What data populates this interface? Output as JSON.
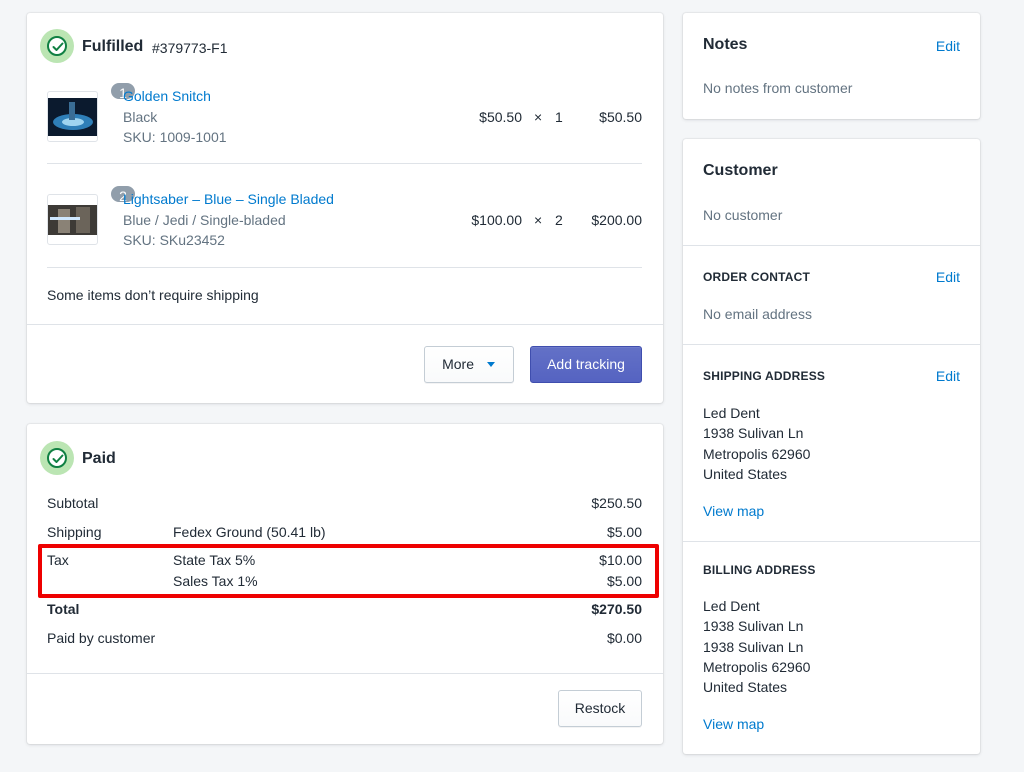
{
  "fulfillment": {
    "status": "Fulfilled",
    "order_id": "#379773-F1",
    "items": [
      {
        "quantity_badge": "1",
        "name": "Golden Snitch",
        "variant": "Black",
        "sku": "SKU: 1009-1001",
        "price": "$50.50",
        "times": "×",
        "qty": "1",
        "total": "$50.50"
      },
      {
        "quantity_badge": "2",
        "name": "Lightsaber – Blue – Single Bladed",
        "variant": "Blue / Jedi / Single-bladed",
        "sku": "SKU: SKu23452",
        "price": "$100.00",
        "times": "×",
        "qty": "2",
        "total": "$200.00"
      }
    ],
    "note": "Some items don’t require shipping",
    "more_label": "More",
    "add_tracking_label": "Add tracking"
  },
  "payment": {
    "status": "Paid",
    "subtotal_label": "Subtotal",
    "subtotal_value": "$250.50",
    "shipping_label": "Shipping",
    "shipping_method": "Fedex Ground (50.41 lb)",
    "shipping_value": "$5.00",
    "tax_label": "Tax",
    "tax_lines": [
      {
        "name": "State Tax 5%",
        "value": "$10.00"
      },
      {
        "name": "Sales Tax 1%",
        "value": "$5.00"
      }
    ],
    "total_label": "Total",
    "total_value": "$270.50",
    "paid_label": "Paid by customer",
    "paid_value": "$0.00",
    "restock_label": "Restock"
  },
  "notes": {
    "title": "Notes",
    "edit_label": "Edit",
    "text": "No notes from customer"
  },
  "customer": {
    "title": "Customer",
    "text": "No customer",
    "order_contact": {
      "title": "ORDER CONTACT",
      "edit_label": "Edit",
      "text": "No email address"
    },
    "shipping_address": {
      "title": "SHIPPING ADDRESS",
      "edit_label": "Edit",
      "lines": [
        "Led Dent",
        "1938 Sulivan Ln",
        "Metropolis 62960",
        "United States"
      ],
      "view_map": "View map"
    },
    "billing_address": {
      "title": "BILLING ADDRESS",
      "lines": [
        "Led Dent",
        "1938 Sulivan Ln",
        "1938 Sulivan Ln",
        "Metropolis 62960",
        "United States"
      ],
      "view_map": "View map"
    }
  },
  "colors": {
    "link": "#007ace",
    "primary_button": "#5c6ac4",
    "success": "#108043",
    "highlight": "#ee0000"
  },
  "icons": {
    "status": "check-circle-icon",
    "dropdown": "caret-down-icon"
  }
}
